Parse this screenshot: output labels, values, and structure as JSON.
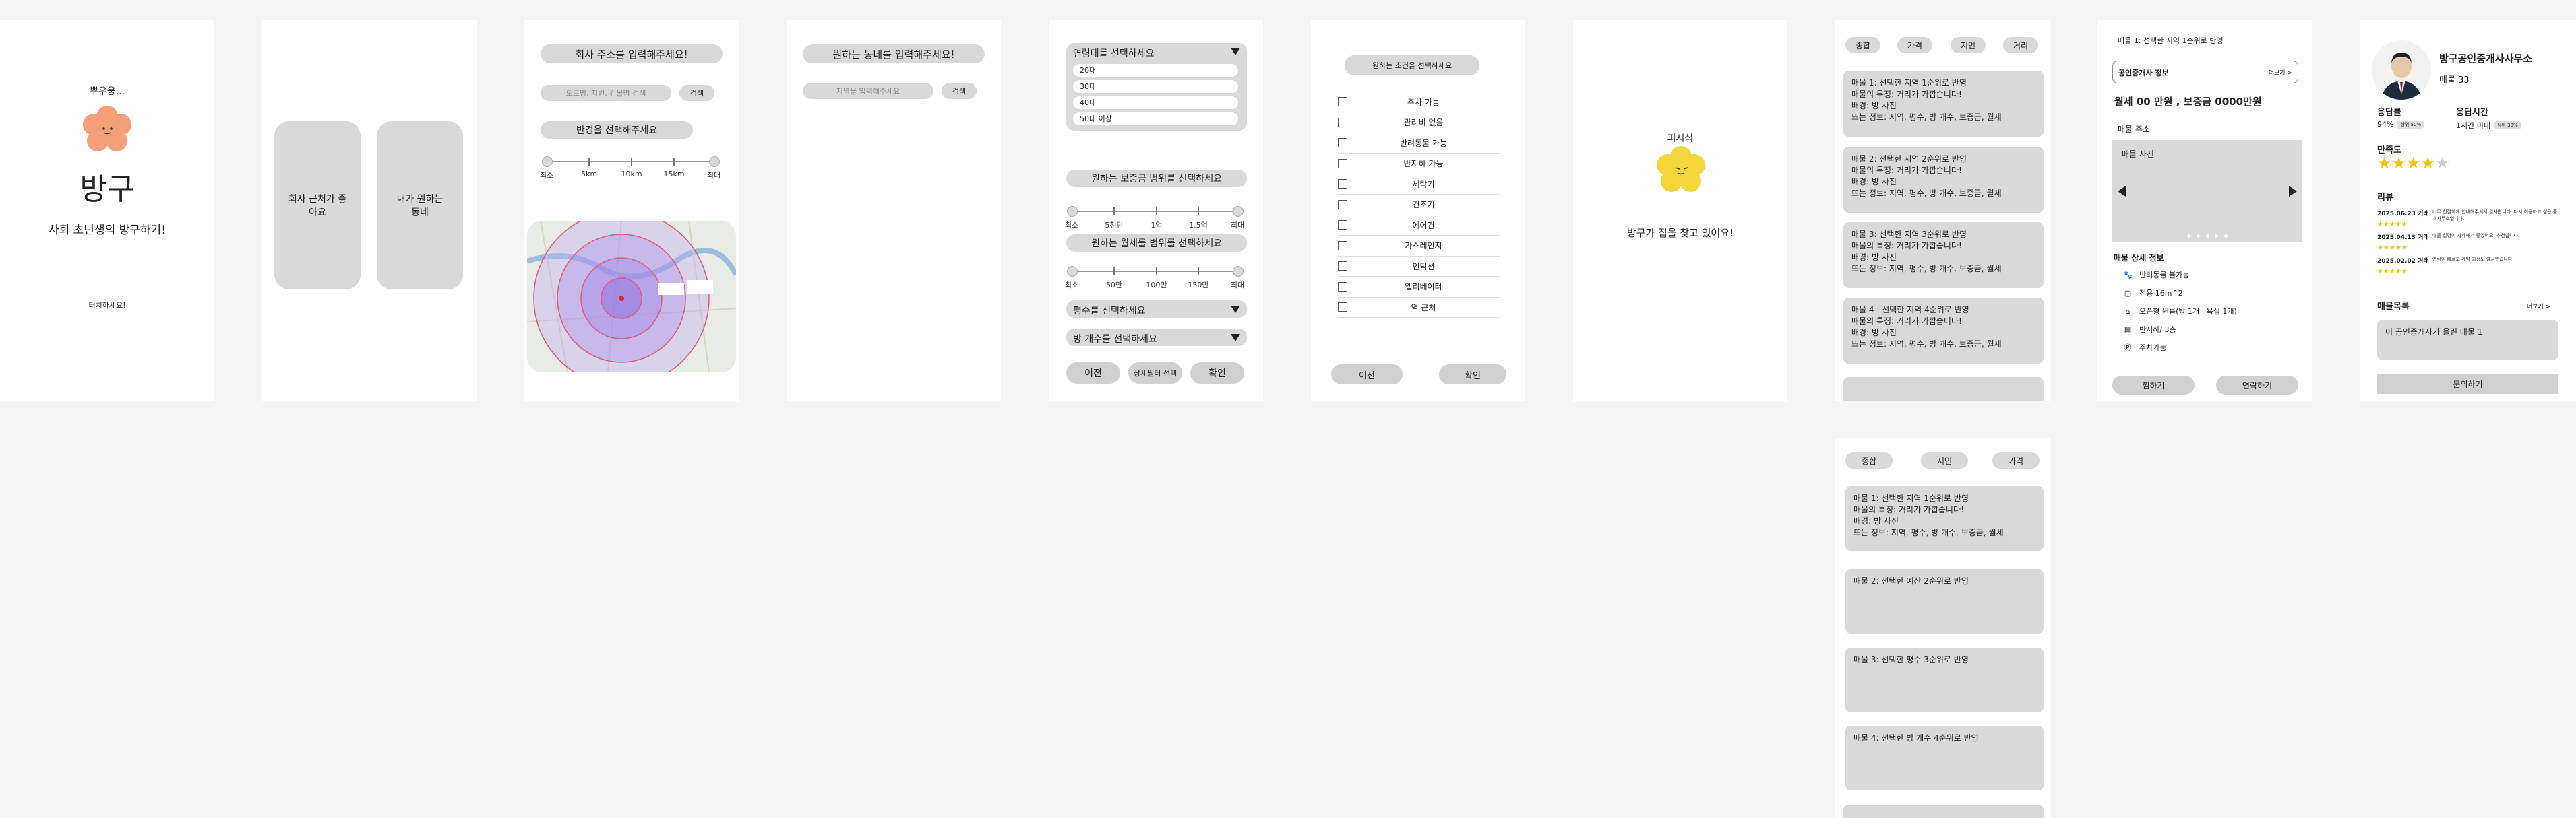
{
  "colors": {
    "mascot": "#f5a07a",
    "mascot_yellow": "#f4d63a",
    "background": "#f5f5f5",
    "panel": "#d9d9d9"
  },
  "screen1": {
    "greeting": "뿌우웅...",
    "app_name": "방구",
    "tagline": "사회 초년생의 방구하기!",
    "touch_hint": "터치하세요!"
  },
  "screen2": {
    "option_company": "회사 근처가 좋아요",
    "option_neighborhood": "내가 원하는 동네"
  },
  "screen3": {
    "title": "회사 주소를 입력해주세요!",
    "search_placeholder": "도로명, 지번, 건물명 검색",
    "search_button": "검색",
    "radius_title": "반경을 선택해주세요",
    "radius_ticks": [
      "최소",
      "5km",
      "10km",
      "15km",
      "최대"
    ]
  },
  "screen4": {
    "title": "원하는 동네를 입력해주세요!",
    "search_placeholder": "지역을 입력해주세요",
    "search_button": "검색"
  },
  "screen5": {
    "age_select": "연령대를 선택하세요",
    "age_options": [
      "20대",
      "30대",
      "40대",
      "50대 이상"
    ],
    "deposit_title": "원하는 보증금 범위를 선택하세요",
    "deposit_ticks": [
      "최소",
      "5천만",
      "1억",
      "1.5억",
      "최대"
    ],
    "rent_title": "원하는 월세를 범위를 선택하세요",
    "rent_ticks": [
      "최소",
      "50만",
      "100만",
      "150만",
      "최대"
    ],
    "area_select": "평수를 선택하세요",
    "rooms_select": "방 개수를 선택하세요",
    "btn_prev": "이전",
    "btn_detail": "상세필터 선택",
    "btn_confirm": "확인"
  },
  "screen6": {
    "title": "원하는 조건을 선택하세요",
    "conditions": [
      "주차 가능",
      "관리비 없음",
      "반려동물 가능",
      "반지하 가능",
      "세탁기",
      "건조기",
      "에어컨",
      "가스레인지",
      "인덕션",
      "엘리베이터",
      "역 근처"
    ],
    "btn_prev": "이전",
    "btn_confirm": "확인"
  },
  "screen7": {
    "label": "피시식",
    "message": "방구가 집을 찾고 있어요!"
  },
  "screen8": {
    "tabs": [
      "종합",
      "가격",
      "지인",
      "거리"
    ],
    "cards": [
      [
        "매물 1: 선택한 지역 1순위로 반영",
        "매물의 특징: 거리가 가깝습니다!",
        "배경: 방 사진",
        "뜨는 정보: 지역, 평수, 방 개수, 보증금, 월세"
      ],
      [
        "매물 2: 선택한 지역 2순위로 반영",
        "매물의 특징: 거리가 가깝습니다!",
        "배경: 방 사진",
        "뜨는 정보: 지역, 평수, 방 개수, 보증금, 월세"
      ],
      [
        "매물 3: 선택한 지역 3순위로 반영",
        "매물의 특징: 거리가 가깝습니다!",
        "배경: 방 사진",
        "뜨는 정보: 지역, 평수, 방 개수, 보증금, 월세"
      ],
      [
        "매물 4 : 선택한 지역 4순위로 반영",
        "매물의 특징: 거리가 가깝습니다!",
        "배경: 방 사진",
        "뜨는 정보: 지역, 평수, 방 개수, 보증금, 월세"
      ]
    ]
  },
  "screen8b": {
    "tabs": [
      "종합",
      "지인",
      "가격"
    ],
    "cards": [
      [
        "매물 1: 선택한 지역 1순위로 반영",
        "매물의 특징: 거리가 가깝습니다!",
        "배경: 방 사진",
        "뜨는 정보: 지역, 평수, 방 개수, 보증금, 월세"
      ],
      [
        "매물 2: 선택한 예산 2순위로 반영"
      ],
      [
        "매물 3: 선택한 평수 3순위로 반영"
      ],
      [
        "매물 4: 선택한 방 개수 4순위로 반영"
      ]
    ]
  },
  "screen9": {
    "header": "매물 1: 선택한 지역 1순위로 반영",
    "agent_box_label": "공인중개사 정보",
    "agent_box_link": "더보기 >",
    "price": "월세 00 만원 , 보증금 0000만원",
    "address": "매물 주소",
    "photo_label": "매물 사진",
    "detail_title": "매물 상세 정보",
    "details": [
      "반려동물 불가능",
      "전용 16m^2",
      "오픈형 원룸(방 1개 , 욕실 1개)",
      "반지하/ 3층",
      "주차가능"
    ],
    "btn_favorite": "찜하기",
    "btn_contact": "연락하기"
  },
  "screen10": {
    "agency_name": "방구공인중개사사무소",
    "listing_label": "매물",
    "listing_count": "33",
    "response_rate_label": "응답률",
    "response_rate_value": "94%",
    "response_rate_badge": "상위 50%",
    "response_time_label": "응답시간",
    "response_time_value": "1시간 이내",
    "response_time_badge": "상위 30%",
    "satisfaction_label": "만족도",
    "satisfaction_stars": 4,
    "review_label": "리뷰",
    "reviews": [
      {
        "date": "2025.06.23 거래",
        "text": "너무 친절하게 안내해주셔서 감사합니다. 다시 이용하고 싶은 중개사무소입니다."
      },
      {
        "date": "2025.04.13 거래",
        "text": "매물 설명이 자세해서 좋았어요. 추천합니다."
      },
      {
        "date": "2025.02.02 거래",
        "text": "연락이 빠르고 계약 과정도 깔끔했습니다."
      }
    ],
    "listings_title": "매물목록",
    "listings_link": "더보기 >",
    "listing_item": "이 공인중개사가 올린 매물 1",
    "btn_inquiry": "문의하기"
  }
}
